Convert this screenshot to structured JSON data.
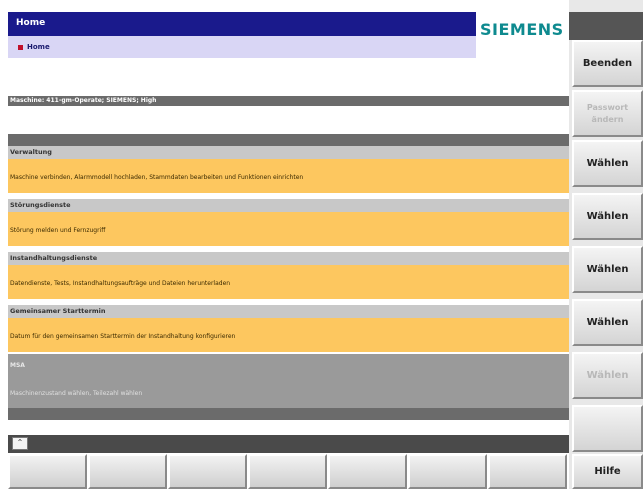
{
  "header": {
    "title": "Home",
    "breadcrumb": "Home"
  },
  "logo": "SIEMENS",
  "machine_line": "Maschine: 411-gm-Operate; SIEMENS; High",
  "sections": [
    {
      "title": "Verwaltung",
      "desc": "Maschine verbinden, Alarmmodell hochladen, Stammdaten bearbeiten und Funktionen einrichten"
    },
    {
      "title": "Störungsdienste",
      "desc": "Störung melden und Fernzugriff"
    },
    {
      "title": "Instandhaltungsdienste",
      "desc": "Datendienste, Tests, Instandhaltungsaufträge und Dateien herunterladen"
    },
    {
      "title": "Gemeinsamer Starttermin",
      "desc": "Datum für den gemeinsamen Starttermin der Instandhaltung konfigurieren"
    }
  ],
  "disabled_section": {
    "title": "MSA",
    "desc": "Maschinenzustand wählen, Teilezahl wählen"
  },
  "vertical_softkeys": [
    {
      "label": "Beenden",
      "enabled": true
    },
    {
      "label": "Passwort ändern",
      "enabled": false
    },
    {
      "label": "Wählen",
      "enabled": true
    },
    {
      "label": "Wählen",
      "enabled": true
    },
    {
      "label": "Wählen",
      "enabled": true
    },
    {
      "label": "Wählen",
      "enabled": true
    },
    {
      "label": "Wählen",
      "enabled": false
    },
    {
      "label": "",
      "enabled": false
    },
    {
      "label": "Hilfe",
      "enabled": true
    }
  ],
  "scroll_up_glyph": "⌃"
}
